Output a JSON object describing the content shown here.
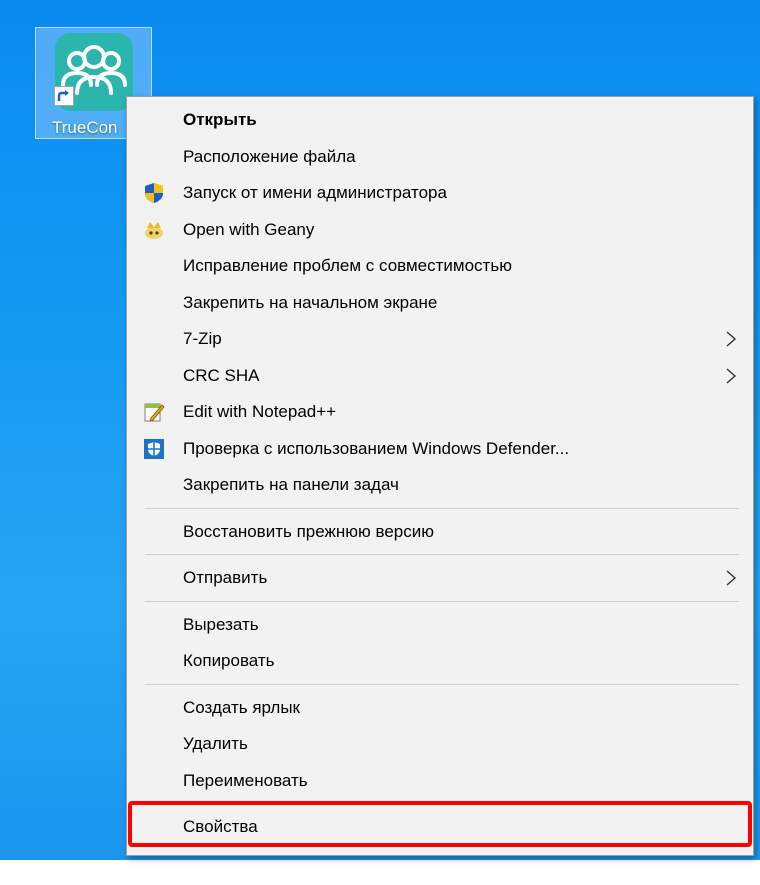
{
  "desktop": {
    "icon_label": "TrueCon",
    "icon_name": "trueconf-people-icon"
  },
  "context_menu": {
    "groups": [
      [
        {
          "label": "Открыть",
          "bold": true,
          "icon": "",
          "submenu": false
        },
        {
          "label": "Расположение файла",
          "icon": "",
          "submenu": false
        },
        {
          "label": "Запуск от имени администратора",
          "icon": "uac-shield-icon",
          "submenu": false
        },
        {
          "label": "Open with Geany",
          "icon": "geany-icon",
          "submenu": false
        },
        {
          "label": "Исправление проблем с совместимостью",
          "icon": "",
          "submenu": false
        },
        {
          "label": "Закрепить на начальном экране",
          "icon": "",
          "submenu": false
        },
        {
          "label": "7-Zip",
          "icon": "",
          "submenu": true
        },
        {
          "label": "CRC SHA",
          "icon": "",
          "submenu": true
        },
        {
          "label": "Edit with Notepad++",
          "icon": "notepadpp-icon",
          "submenu": false
        },
        {
          "label": "Проверка с использованием Windows Defender...",
          "icon": "windows-defender-icon",
          "submenu": false
        },
        {
          "label": "Закрепить на панели задач",
          "icon": "",
          "submenu": false
        }
      ],
      [
        {
          "label": "Восстановить прежнюю версию",
          "icon": "",
          "submenu": false
        }
      ],
      [
        {
          "label": "Отправить",
          "icon": "",
          "submenu": true
        }
      ],
      [
        {
          "label": "Вырезать",
          "icon": "",
          "submenu": false
        },
        {
          "label": "Копировать",
          "icon": "",
          "submenu": false
        }
      ],
      [
        {
          "label": "Создать ярлык",
          "icon": "",
          "submenu": false
        },
        {
          "label": "Удалить",
          "icon": "",
          "submenu": false
        },
        {
          "label": "Переименовать",
          "icon": "",
          "submenu": false
        }
      ],
      [
        {
          "label": "Свойства",
          "icon": "",
          "submenu": false,
          "highlighted": true
        }
      ]
    ]
  },
  "colors": {
    "menu_background": "#f2f2f2",
    "highlight_border": "#ff0000",
    "app_icon_teal": "#2cb5ad"
  }
}
